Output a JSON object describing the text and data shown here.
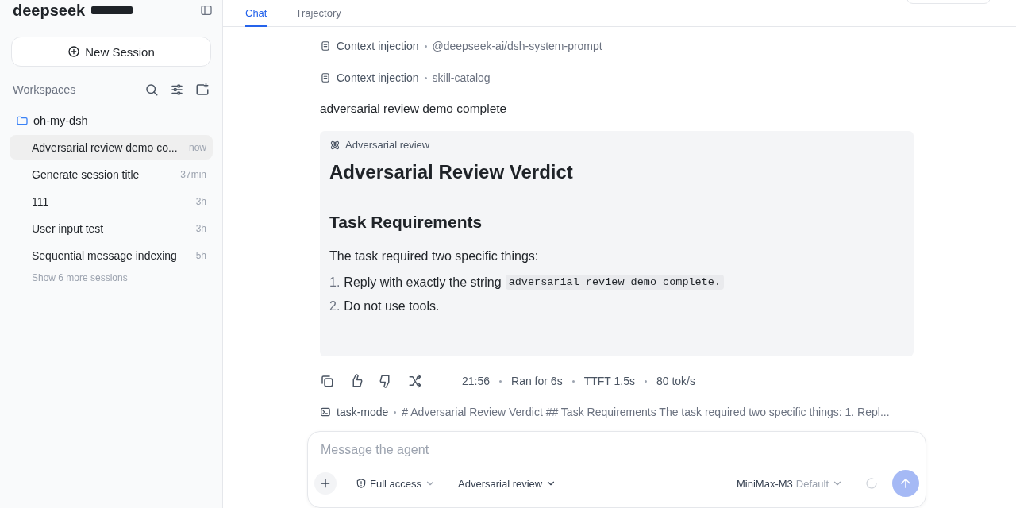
{
  "sidebar": {
    "brand": "deepseek",
    "new_session": "New Session",
    "section_title": "Workspaces",
    "workspace": {
      "name": "oh-my-dsh",
      "sessions": [
        {
          "title": "Adversarial review demo co...",
          "time": "now",
          "selected": true
        },
        {
          "title": "Generate session title",
          "time": "37min",
          "selected": false
        },
        {
          "title": "111",
          "time": "3h",
          "selected": false
        },
        {
          "title": "User input test",
          "time": "3h",
          "selected": false
        },
        {
          "title": "Sequential message indexing",
          "time": "5h",
          "selected": false
        }
      ]
    },
    "show_more": "Show 6 more sessions"
  },
  "tabs": [
    {
      "label": "Chat",
      "selected": true
    },
    {
      "label": "Trajectory",
      "selected": false
    }
  ],
  "context_injections": [
    {
      "label": "Context injection",
      "source": "@deepseek-ai/dsh-system-prompt"
    },
    {
      "label": "Context injection",
      "source": "skill-catalog"
    }
  ],
  "reply": "adversarial review demo complete",
  "review_card": {
    "tag": "Adversarial review",
    "heading": "Adversarial Review Verdict",
    "subheading": "Task Requirements",
    "intro": "The task required two specific things:",
    "items": [
      {
        "number": "1.",
        "text": "Reply with exactly the string",
        "code": "adversarial review demo complete."
      },
      {
        "number": "2.",
        "text": "Do not use tools."
      }
    ]
  },
  "message_meta": [
    "21:56",
    "Ran for 6s",
    "TTFT 1.5s",
    "80 tok/s"
  ],
  "task": {
    "label": "task-mode",
    "summary": "# Adversarial Review Verdict ## Task Requirements The task required two specific things: 1. Repl..."
  },
  "composer": {
    "placeholder": "Message the agent",
    "access": "Full access",
    "mode": "Adversarial review",
    "model": "MiniMax-M3",
    "model_note": "Default"
  }
}
